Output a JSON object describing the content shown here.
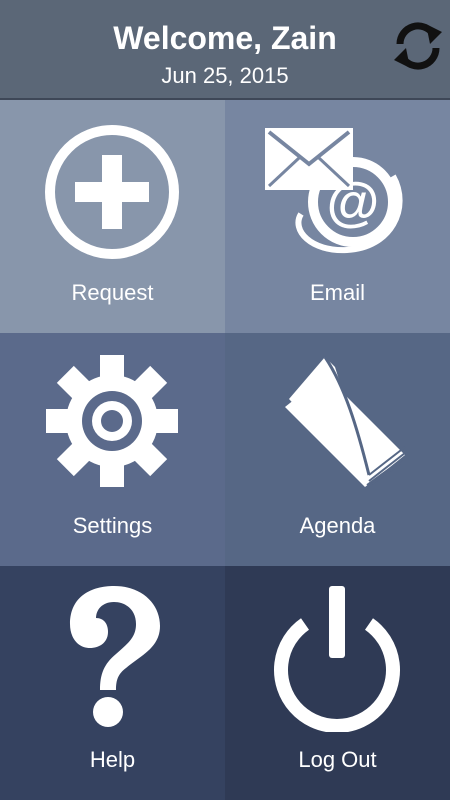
{
  "header": {
    "welcome": "Welcome, Zain",
    "date": "Jun 25, 2015",
    "refresh_icon": "refresh-icon"
  },
  "tiles": [
    {
      "label": "Request",
      "icon": "plus-circle-icon",
      "color": "#8896ab"
    },
    {
      "label": "Email",
      "icon": "email-icon",
      "color": "#7786a1"
    },
    {
      "label": "Settings",
      "icon": "gear-icon",
      "color": "#5b6a8b"
    },
    {
      "label": "Agenda",
      "icon": "book-icon",
      "color": "#566785"
    },
    {
      "label": "Help",
      "icon": "question-mark-icon",
      "color": "#354260"
    },
    {
      "label": "Log Out",
      "icon": "power-icon",
      "color": "#2f3a55"
    }
  ]
}
